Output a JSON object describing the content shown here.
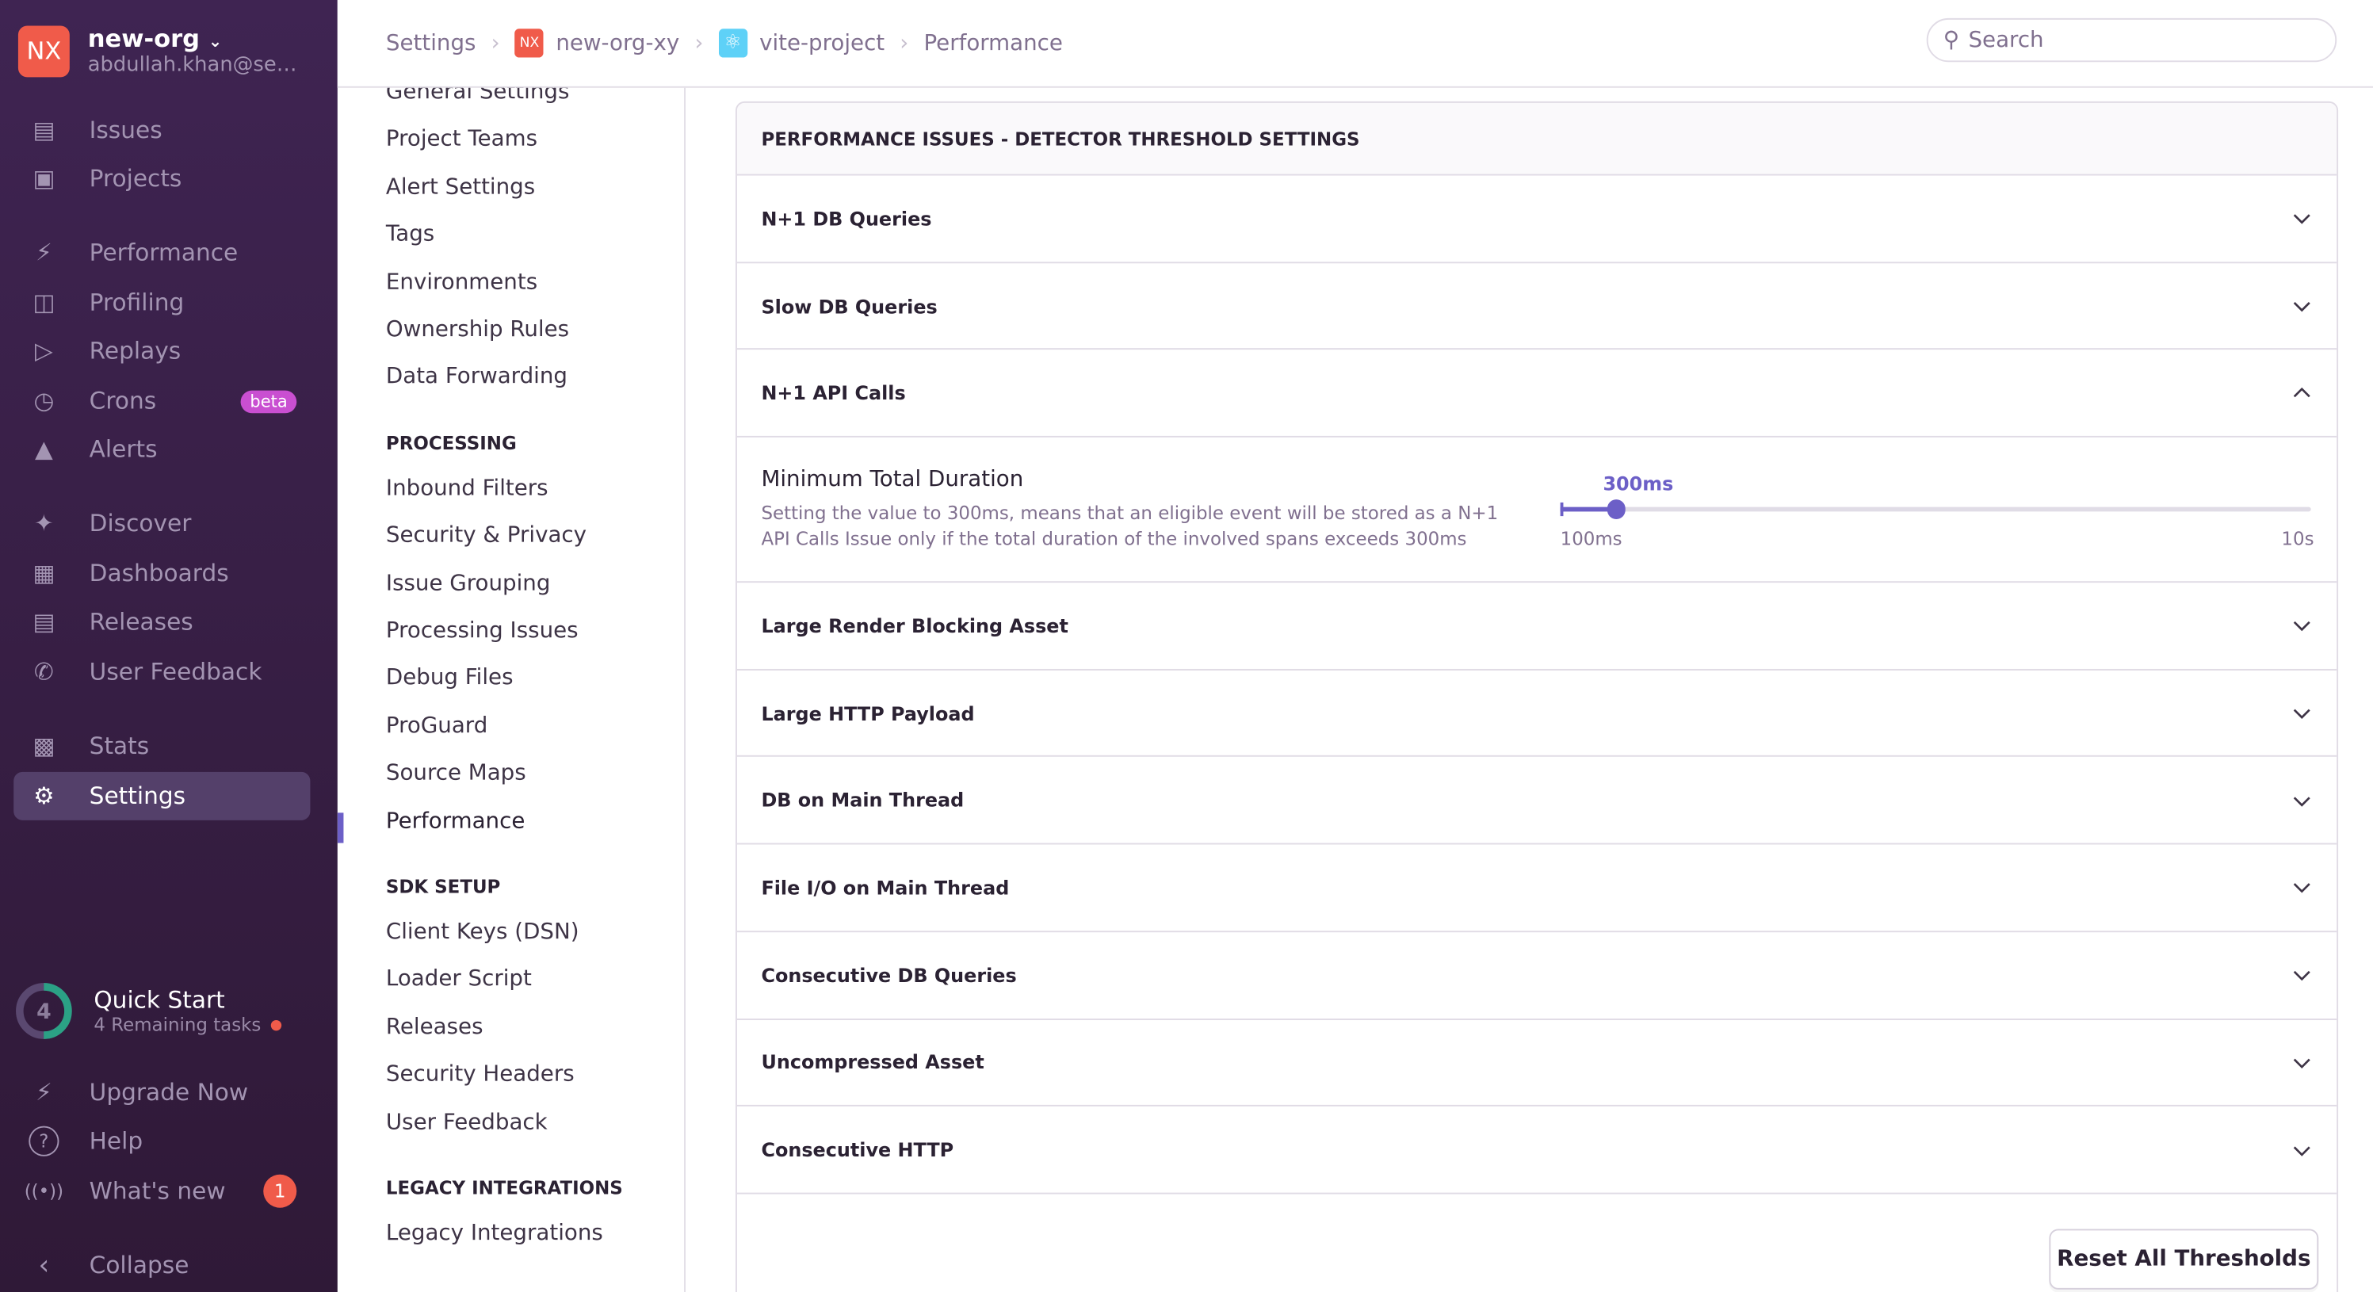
{
  "org": {
    "initials": "NX",
    "name": "new-org",
    "email": "abdullah.khan@sentry.io",
    "color": "#f05b4a"
  },
  "sidebar": {
    "items": [
      {
        "label": "Issues",
        "icon": "issues-icon"
      },
      {
        "label": "Projects",
        "icon": "projects-icon"
      },
      {
        "label": "Performance",
        "icon": "lightning-icon"
      },
      {
        "label": "Profiling",
        "icon": "profiling-icon"
      },
      {
        "label": "Replays",
        "icon": "play-icon"
      },
      {
        "label": "Crons",
        "icon": "clock-icon",
        "badge": "beta"
      },
      {
        "label": "Alerts",
        "icon": "siren-icon"
      },
      {
        "label": "Discover",
        "icon": "telescope-icon"
      },
      {
        "label": "Dashboards",
        "icon": "dashboard-icon"
      },
      {
        "label": "Releases",
        "icon": "package-icon"
      },
      {
        "label": "User Feedback",
        "icon": "megaphone-icon"
      },
      {
        "label": "Stats",
        "icon": "stats-icon"
      },
      {
        "label": "Settings",
        "icon": "gear-icon",
        "active": true
      }
    ],
    "quick_start": {
      "title": "Quick Start",
      "count": "4",
      "subtitle": "4 Remaining tasks",
      "progress": 0.5
    },
    "bottom": [
      {
        "label": "Upgrade Now"
      },
      {
        "label": "Help"
      },
      {
        "label": "What's new",
        "count": "1"
      },
      {
        "label": "Collapse"
      }
    ]
  },
  "breadcrumb": [
    "Settings",
    "new-org-xy",
    "vite-project",
    "Performance"
  ],
  "breadcrumb_icons": {
    "org": "NX"
  },
  "search": {
    "placeholder": "Search"
  },
  "settings_nav": {
    "items1": [
      "General Settings",
      "Project Teams",
      "Alert Settings",
      "Tags",
      "Environments",
      "Ownership Rules",
      "Data Forwarding"
    ],
    "processing_header": "PROCESSING",
    "items2": [
      "Inbound Filters",
      "Security & Privacy",
      "Issue Grouping",
      "Processing Issues",
      "Debug Files",
      "ProGuard",
      "Source Maps",
      "Performance"
    ],
    "sdk_header": "SDK SETUP",
    "items3": [
      "Client Keys (DSN)",
      "Loader Script",
      "Releases",
      "Security Headers",
      "User Feedback"
    ],
    "legacy_header": "LEGACY INTEGRATIONS",
    "items4": [
      "Legacy Integrations"
    ],
    "active": "Performance"
  },
  "panel": {
    "title": "PERFORMANCE ISSUES - DETECTOR THRESHOLD SETTINGS",
    "rows": [
      "N+1 DB Queries",
      "Slow DB Queries",
      "N+1 API Calls",
      "Large Render Blocking Asset",
      "Large HTTP Payload",
      "DB on Main Thread",
      "File I/O on Main Thread",
      "Consecutive DB Queries",
      "Uncompressed Asset",
      "Consecutive HTTP"
    ],
    "expanded": {
      "label": "Minimum Total Duration",
      "description": "Setting the value to 300ms, means that an eligible event will be stored as a N+1 API Calls Issue only if the total duration of the involved spans exceeds 300ms",
      "value_label": "300ms",
      "min_label": "100ms",
      "max_label": "10s",
      "fraction": 0.075
    },
    "reset_label": "Reset All Thresholds"
  },
  "colors": {
    "accent": "#6c5fc7",
    "sidebar": "#3f2452",
    "badge": "#f05b4a",
    "progress": "#2ba185"
  }
}
